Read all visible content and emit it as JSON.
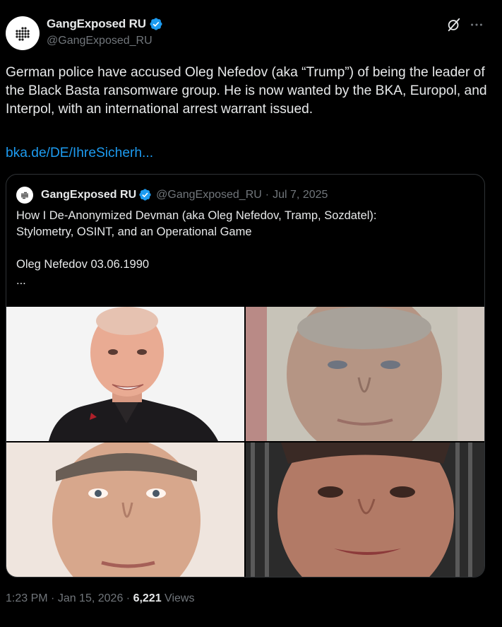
{
  "author": {
    "name": "GangExposed RU",
    "handle": "@GangExposed_RU",
    "verified": true
  },
  "tweet": {
    "text": "German police have accused Oleg Nefedov (aka “Trump”) of being the leader of the Black Basta ransomware group. He is now wanted by the BKA, Europol, and Interpol, with an international arrest warrant issued.",
    "link": "bka.de/DE/IhreSicherh..."
  },
  "quote": {
    "name": "GangExposed RU",
    "handle": "@GangExposed_RU",
    "separator": "·",
    "date": "Jul 7, 2025",
    "lines": [
      "How I De-Anonymized Devman (aka Oleg Nefedov, Tramp, Sozdatel):",
      "Stylometry, OSINT, and an Operational Game",
      "",
      "Oleg Nefedov 03.06.1990",
      "..."
    ],
    "photos": [
      {
        "kind": "portrait-white-background"
      },
      {
        "kind": "document-photo-faded"
      },
      {
        "kind": "portrait-neutral-background"
      },
      {
        "kind": "closeup-dark-background"
      }
    ]
  },
  "footer": {
    "time": "1:23 PM",
    "separator1": " · ",
    "date": "Jan 15, 2026",
    "separator2": " · ",
    "views_count": "6,221",
    "views_label": " Views"
  },
  "colors": {
    "background": "#000000",
    "text": "#e7e9ea",
    "muted": "#71767b",
    "link": "#1d9bf0",
    "verified": "#1d9bf0",
    "border": "#2f3336"
  },
  "icons": {
    "avatar": "dot-grid-logo-icon",
    "verified": "verified-badge-icon",
    "grok": "grok-icon",
    "more": "more-horizontal-icon"
  }
}
